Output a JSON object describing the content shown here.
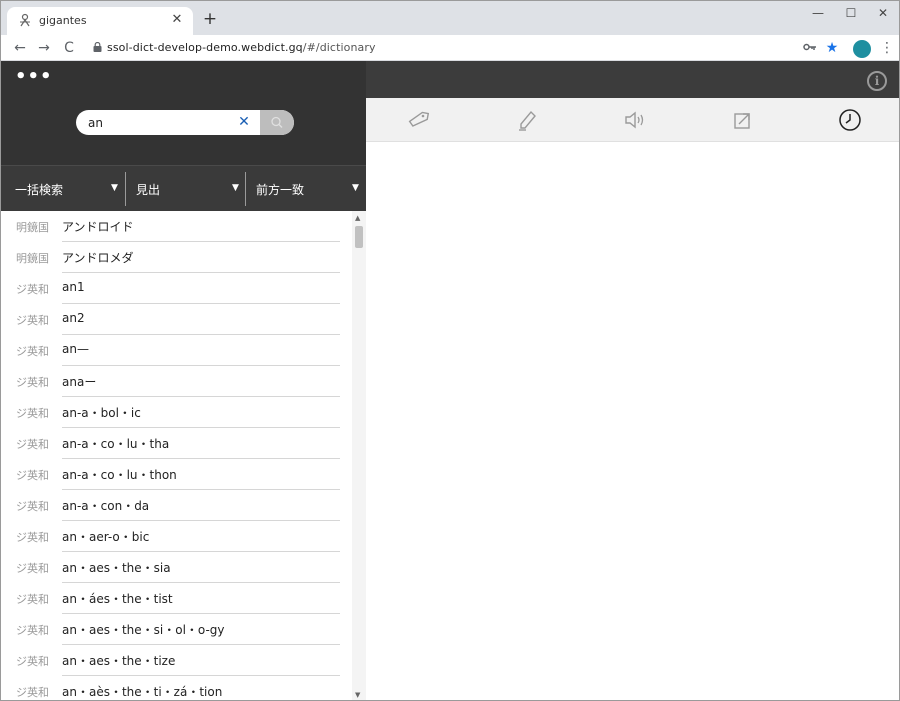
{
  "browser": {
    "tab_title": "gigantes",
    "tab_close": "✕",
    "new_tab": "+",
    "url_host": "ssol-dict-develop-demo.webdict.gq",
    "url_path": "/#/dictionary",
    "back": "←",
    "forward": "→",
    "reload": "C",
    "minimize": "—",
    "maximize": "☐",
    "close": "✕",
    "menu": "⋮"
  },
  "app": {
    "more_menu": "•••",
    "info": "i"
  },
  "search": {
    "query": "an",
    "clear": "✕"
  },
  "filters": [
    {
      "label": "一括検索",
      "arrow": "▼"
    },
    {
      "label": "見出",
      "arrow": "▼"
    },
    {
      "label": "前方一致",
      "arrow": "▼"
    }
  ],
  "results": [
    {
      "dict": "明鏡国",
      "word": "アンドロイド"
    },
    {
      "dict": "明鏡国",
      "word": "アンドロメダ"
    },
    {
      "dict": "ジ英和",
      "word": "an1"
    },
    {
      "dict": "ジ英和",
      "word": "an2"
    },
    {
      "dict": "ジ英和",
      "word": "an—"
    },
    {
      "dict": "ジ英和",
      "word": "anaー"
    },
    {
      "dict": "ジ英和",
      "word": "an-a・bol・ic"
    },
    {
      "dict": "ジ英和",
      "word": "an-a・co・lu・tha"
    },
    {
      "dict": "ジ英和",
      "word": "an-a・co・lu・thon"
    },
    {
      "dict": "ジ英和",
      "word": "an-a・con・da"
    },
    {
      "dict": "ジ英和",
      "word": "an・aer-o・bic"
    },
    {
      "dict": "ジ英和",
      "word": "an・aes・the・sia"
    },
    {
      "dict": "ジ英和",
      "word": "an・áes・the・tist"
    },
    {
      "dict": "ジ英和",
      "word": "an・aes・the・si・ol・o-gy"
    },
    {
      "dict": "ジ英和",
      "word": "an・aes・the・tize"
    },
    {
      "dict": "ジ英和",
      "word": "an・aès・the・ti・zá・tion"
    }
  ],
  "colors": {
    "header": "#3c3c3c",
    "search_panel": "#333333",
    "icon_bar": "#f1f1f1",
    "profile": "#1e8fa0",
    "clear_icon": "#1a5fb4"
  },
  "icons": [
    "tag-icon",
    "pen-icon",
    "speaker-icon",
    "jump-icon",
    "history-clock-icon"
  ]
}
